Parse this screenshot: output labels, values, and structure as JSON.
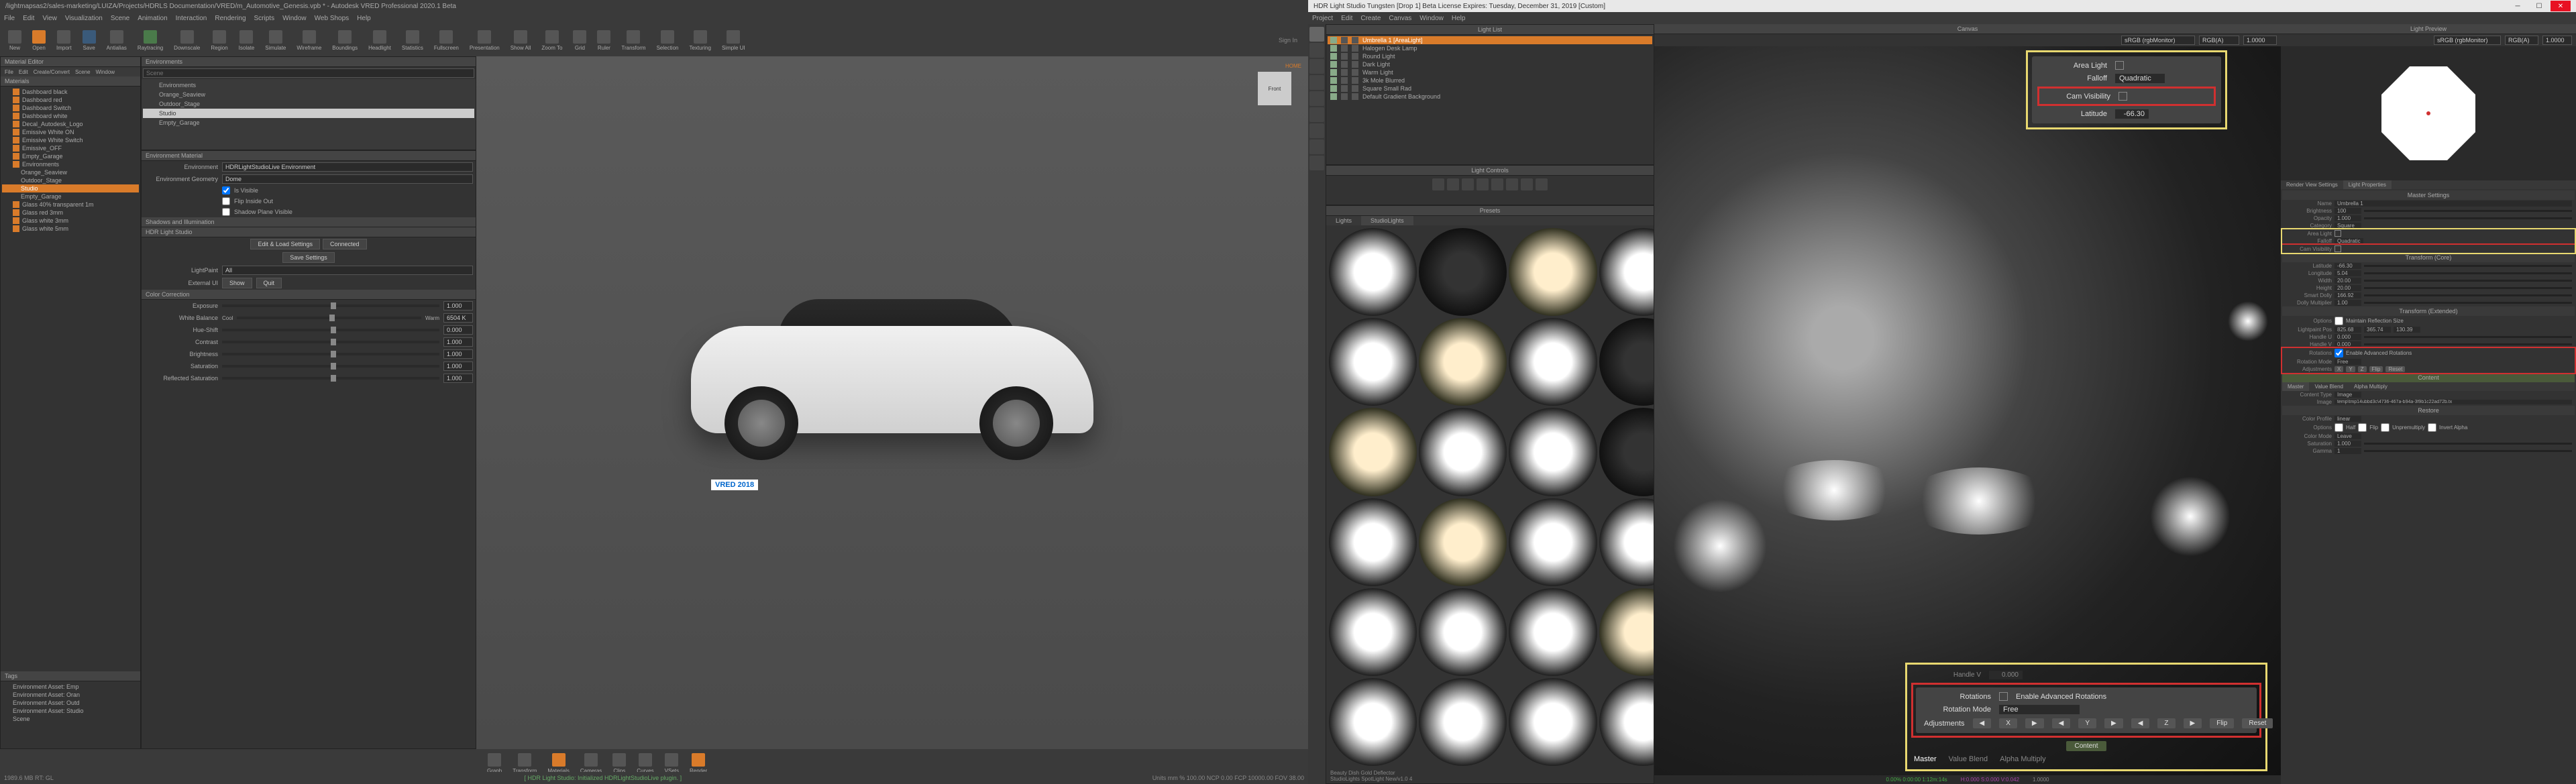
{
  "vred": {
    "title": "/lightmapsas2/sales-marketing/LUIZA/Projects/HDRLS Documentation/VRED/m_Automotive_Genesis.vpb * - Autodesk VRED Professional 2020.1 Beta",
    "menubar": [
      "File",
      "Edit",
      "View",
      "Visualization",
      "Scene",
      "Animation",
      "Interaction",
      "Rendering",
      "Scripts",
      "Window",
      "Web Shops",
      "Help"
    ],
    "toolbar": [
      "New",
      "Open",
      "Import",
      "Save",
      "Antialias",
      "Raytracing",
      "Downscale",
      "Region",
      "Isolate",
      "Simulate",
      "Wireframe",
      "Boundings",
      "Headlight",
      "Statistics",
      "Fullscreen",
      "Presentation",
      "Show All",
      "Zoom To",
      "Grid",
      "Ruler",
      "Transform",
      "Selection",
      "Texturing",
      "Simple UI"
    ],
    "signin": "Sign In",
    "material_editor": {
      "title": "Material Editor",
      "menu": [
        "File",
        "Edit",
        "Create/Convert",
        "Scene",
        "Window"
      ],
      "materials_label": "Materials",
      "items": [
        {
          "name": "Dashboard black",
          "on": true
        },
        {
          "name": "Dashboard red",
          "on": true
        },
        {
          "name": "Dashboard Switch",
          "on": true
        },
        {
          "name": "Dashboard white",
          "on": true
        },
        {
          "name": "Decal_Autodesk_Logo",
          "on": true
        },
        {
          "name": "Emissive White ON",
          "on": true
        },
        {
          "name": "Emissive White Switch",
          "on": true
        },
        {
          "name": "Emissive_OFF",
          "on": true
        },
        {
          "name": "Empty_Garage",
          "on": true
        },
        {
          "name": "Environments",
          "on": true,
          "header": true
        },
        {
          "name": "Orange_Seaview",
          "sub": true
        },
        {
          "name": "Outdoor_Stage",
          "sub": true
        },
        {
          "name": "Studio",
          "sub": true,
          "selected": true
        },
        {
          "name": "Empty_Garage",
          "sub": true
        },
        {
          "name": "Glass 40% transparent 1m",
          "on": true
        },
        {
          "name": "Glass red 3mm",
          "on": true
        },
        {
          "name": "Glass white 3mm",
          "on": true
        },
        {
          "name": "Glass white 5mm",
          "on": true
        }
      ],
      "tags_label": "Tags",
      "tags": [
        {
          "name": "Environment Asset: Emp"
        },
        {
          "name": "Environment Asset: Oran"
        },
        {
          "name": "Environment Asset: Outd"
        },
        {
          "name": "Environment Asset: Studio"
        },
        {
          "name": "Scene"
        }
      ]
    },
    "env_panel": {
      "title": "Environments",
      "search_placeholder": "Scene",
      "tree": [
        "Environments",
        "Orange_Seaview",
        "Outdoor_Stage",
        "Studio",
        "Empty_Garage"
      ]
    },
    "env_material": {
      "header": "Environment Material",
      "env_label": "Environment",
      "env_value": "HDRLightStudioLive Environment",
      "geom_label": "Environment Geometry",
      "geom_value": "Dome",
      "is_visible": "Is Visible",
      "flip_inside": "Flip Inside Out",
      "shadow_plane": "Shadow Plane Visible"
    },
    "hdr_studio": {
      "header": "HDR Light Studio",
      "edit_load": "Edit & Load Settings",
      "connected": "Connected",
      "save_settings": "Save Settings",
      "lightpaint_label": "LightPaint",
      "lightpaint_val": "All",
      "external_label": "External UI",
      "show": "Show",
      "quit": "Quit"
    },
    "shadows_header": "Shadows and Illumination",
    "color_correction": {
      "header": "Color Correction",
      "exposure": "Exposure",
      "exposure_val": "1.000",
      "whitebalance": "White Balance",
      "cool": "Cool",
      "warm": "Warm",
      "wb_val": "6504 K",
      "hueshift": "Hue-Shift",
      "hue_val": "0.000",
      "contrast": "Contrast",
      "contrast_val": "1.000",
      "brightness": "Brightness",
      "bright_val": "1.000",
      "saturation": "Saturation",
      "sat_val": "1.000",
      "refl_sat": "Reflected Saturation",
      "rsat_val": "1.000"
    },
    "plate": "VRED 2018",
    "viewcube": {
      "home": "HOME",
      "face": "Front"
    },
    "bottom_tools": [
      "Graph",
      "Transform",
      "Materials",
      "Cameras",
      "Clips",
      "Curves",
      "VSets",
      "Render"
    ],
    "status_left": "1989.6 MB   RT: GL",
    "status_log": "[ HDR Light Studio: Initialized HDRLightStudioLive plugin. ]",
    "status_right": "Units  mm   %  100.00   NCP  0.00   FCP  10000.00   FOV  38.00"
  },
  "hdrls": {
    "title": "HDR Light Studio Tungsten [Drop 1] Beta License Expires: Tuesday, December 31, 2019  [Custom]",
    "menubar": [
      "Project",
      "Edit",
      "Create",
      "Canvas",
      "Window",
      "Help"
    ],
    "lightlist": {
      "header": "Light List",
      "items": [
        {
          "name": "Umbrella 1 [AreaLight]",
          "sel": true
        },
        {
          "name": "Halogen Desk Lamp"
        },
        {
          "name": "Round Light"
        },
        {
          "name": "Dark Light"
        },
        {
          "name": "Warm Light"
        },
        {
          "name": "3k Mole Blurred"
        },
        {
          "name": "Square Small Rad"
        },
        {
          "name": "Default Gradient Background"
        }
      ]
    },
    "light_controls": "Light Controls",
    "presets": {
      "header": "Presets",
      "tab1": "Lights",
      "tab2": "StudioLights",
      "footer1": "Beauty Dish Gold Deflector",
      "footer2": "StudioLights SpotLight New/v1.0  4"
    },
    "canvas": {
      "header": "Canvas",
      "colorspace": "sRGB (rgbMonitor)",
      "channel": "RGB(A)",
      "exposure": "1.0000"
    },
    "callout_area": {
      "arealight": "Area Light",
      "falloff": "Falloff",
      "falloff_val": "Quadratic",
      "camvis": "Cam Visibility",
      "latitude": "Latitude",
      "lat_val": "-66.30"
    },
    "callout_rot": {
      "rotations": "Rotations",
      "enable": "Enable Advanced Rotations",
      "mode": "Rotation Mode",
      "mode_val": "Free",
      "adjustments": "Adjustments",
      "x": "X",
      "y": "Y",
      "z": "Z",
      "flip": "Flip",
      "reset": "Reset",
      "content": "Content",
      "tabs": [
        "Master",
        "Value Blend",
        "Alpha Multiply"
      ]
    },
    "preview": {
      "header": "Light Preview",
      "colorspace": "sRGB (rgbMonitor)",
      "channel": "RGB(A)",
      "exposure": "1.0000"
    },
    "props": {
      "tab1": "Render View Settings",
      "tab2": "Light Properties",
      "master": "Master Settings",
      "name_lbl": "Name",
      "name_val": "Umbrella 1",
      "brightness_lbl": "Brightness",
      "brightness_val": "100",
      "opacity_lbl": "Opacity",
      "opacity_val": "1.000",
      "category_lbl": "Category",
      "category_val": "Square",
      "arealight": "Area Light",
      "falloff": "Falloff",
      "falloff_val": "Quadratic",
      "camvis": "Cam Visibility",
      "transform_core": "Transform (Core)",
      "latitude": "Latitude",
      "lat_val": "-66.30",
      "longitude": "Longitude",
      "lon_val": "5.04",
      "width": "Width",
      "w_val": "20.00",
      "height": "Height",
      "h_val": "20.00",
      "smart_dolly": "Smart Dolly",
      "sd_val": "166.92",
      "dolly_mult": "Dolly Multiplier",
      "dm_val": "1.00",
      "transform_ext": "Transform (Extended)",
      "options": "Options",
      "maintain_refl": "Maintain Reflection Size",
      "lightpaint_pos": "Lightpaint Pos",
      "lp1": "825.68",
      "lp2": "365.74",
      "lp3": "130.39",
      "handle_u": "Handle U",
      "hu": "0.000",
      "handle_v": "Handle V",
      "hv": "0.000",
      "rotations": "Rotations",
      "enable_adv": "Enable Advanced Rotations",
      "rotation_mode": "Rotation Mode",
      "rm_val": "Free",
      "adjustments": "Adjustments",
      "flip": "Flip",
      "reset": "Reset",
      "content": "Content",
      "ctabs": [
        "Master",
        "Value Blend",
        "Alpha Multiply"
      ],
      "content_type": "Content Type",
      "ct_val": "Image",
      "image": "Image",
      "img_val": "temp\\tmp14ubbd3c\\4736-467a-b94a-3f9b1c22ad72b.tx",
      "restore": "Restore",
      "color_profile": "Color Profile",
      "cp_val": "linear",
      "options2": "Options",
      "half": "Half",
      "flip2": "Flip",
      "unpre": "Unpremultiply",
      "invert": "Invert Alpha",
      "color_mode": "Color Mode",
      "cm_val": "Leave",
      "saturation": "Saturation",
      "sat_val": "1.000",
      "gamma": "Gamma",
      "g_val": "1"
    },
    "status": {
      "left": "0.00% 0:00:00 1:12m:14s",
      "mid": "H:0.000 S:0.000 V:0.042",
      "right": "1.0000"
    }
  }
}
